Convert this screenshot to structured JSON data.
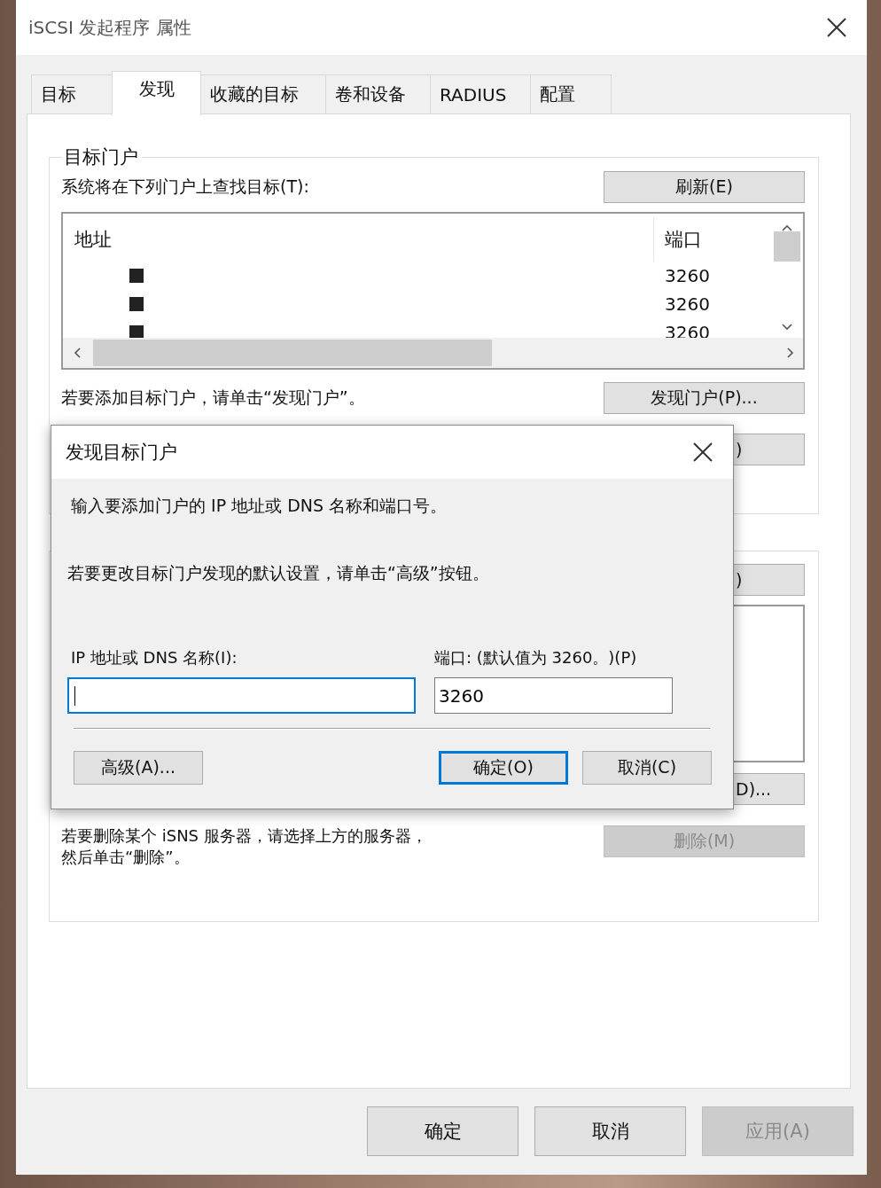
{
  "window": {
    "title": "iSCSI 发起程序 属性"
  },
  "tabs": [
    {
      "label": "目标",
      "selected": false
    },
    {
      "label": "发现",
      "selected": true
    },
    {
      "label": "收藏的目标",
      "selected": false
    },
    {
      "label": "卷和设备",
      "selected": false
    },
    {
      "label": "RADIUS",
      "selected": false
    },
    {
      "label": "配置",
      "selected": false
    }
  ],
  "target_portals": {
    "title": "目标门户",
    "list_label": "系统将在下列门户上查找目标(T):",
    "refresh_button": "刷新(E)",
    "columns": [
      "地址",
      "端口"
    ],
    "rows": [
      {
        "port": "3260"
      },
      {
        "port": "3260"
      },
      {
        "port": "3260"
      }
    ],
    "add_hint": "若要添加目标门户，请单击“发现门户”。",
    "discover_button": "发现门户(P)...",
    "covered_button": ")"
  },
  "isns_servers": {
    "covered_button": ")",
    "add_button": "D)...",
    "remove_hint": [
      "若要删除某个 iSNS 服务器，请选择上方的服务器，",
      "然后单击“删除”。"
    ],
    "remove_button": {
      "label": "删除(M)",
      "disabled": true
    }
  },
  "dialog": {
    "title": "发现目标门户",
    "intro": "输入要添加门户的 IP 地址或 DNS 名称和端口号。",
    "advanced_hint": "若要更改目标门户发现的默认设置，请单击“高级”按钮。",
    "address_field": {
      "label": "IP 地址或 DNS 名称(I):",
      "focused": true
    },
    "port_field": {
      "label": "端口: (默认值为 3260。)(P)",
      "value": "3260",
      "focused": false
    },
    "buttons": [
      {
        "label": "高级(A)...",
        "default": false
      },
      {
        "label": "确定(O)",
        "default": true
      },
      {
        "label": "取消(C)",
        "default": false
      }
    ]
  },
  "buttons": [
    {
      "label": "确定",
      "disabled": false
    },
    {
      "label": "取消",
      "disabled": false
    },
    {
      "label": "应用(A)",
      "disabled": true
    }
  ]
}
